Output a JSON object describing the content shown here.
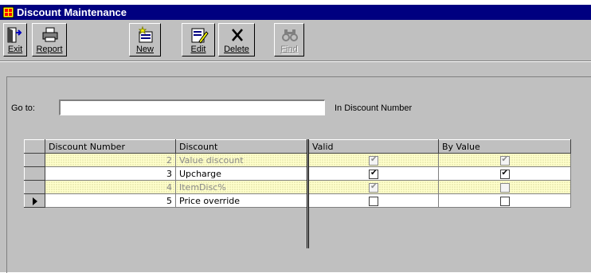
{
  "window": {
    "title": "Discount Maintenance"
  },
  "toolbar": {
    "buttons": [
      {
        "label": "Exit",
        "icon": "exit-door-icon",
        "enabled": true
      },
      {
        "label": "Report",
        "icon": "printer-icon",
        "enabled": true
      },
      {
        "label": "New",
        "icon": "new-record-icon",
        "enabled": true
      },
      {
        "label": "Edit",
        "icon": "edit-record-icon",
        "enabled": true
      },
      {
        "label": "Delete",
        "icon": "delete-x-icon",
        "enabled": true
      },
      {
        "label": "Find",
        "icon": "binoculars-icon",
        "enabled": false
      }
    ]
  },
  "goto": {
    "label": "Go to:",
    "value": "",
    "suffix": "In Discount Number"
  },
  "grid": {
    "columns": [
      "Discount Number",
      "Discount",
      "Valid",
      "By Value"
    ],
    "rows": [
      {
        "number": "2",
        "discount": "Value discount",
        "valid": true,
        "by_value": true,
        "style": "hatched",
        "current": false
      },
      {
        "number": "3",
        "discount": "Upcharge",
        "valid": true,
        "by_value": true,
        "style": "normal",
        "current": false
      },
      {
        "number": "4",
        "discount": "ItemDisc%",
        "valid": true,
        "by_value": false,
        "style": "hatched",
        "current": false
      },
      {
        "number": "5",
        "discount": "Price override",
        "valid": false,
        "by_value": false,
        "style": "normal",
        "current": true
      }
    ]
  },
  "colors": {
    "titlebar": "#000080",
    "face": "#c0c0c0",
    "hatched_row": "#ffffcc"
  }
}
